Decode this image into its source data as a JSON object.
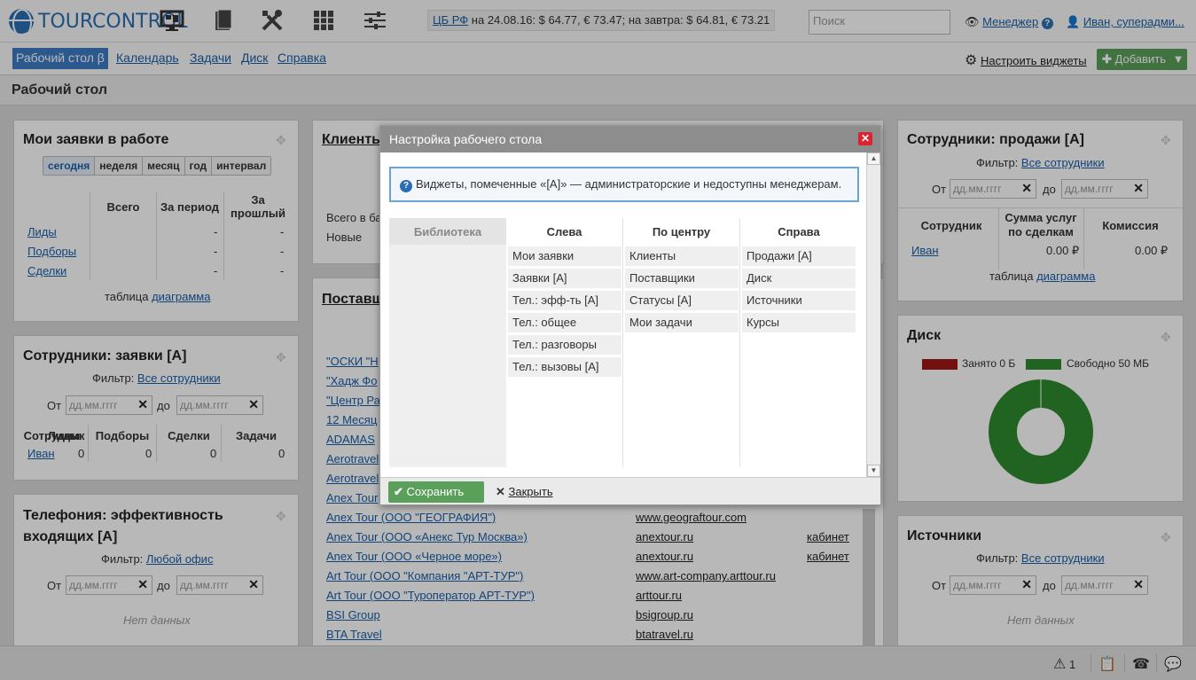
{
  "header": {
    "logo_text": "TOURCONTROL",
    "currency_link": "ЦБ РФ",
    "currency_text": "на 24.08.16: $ 64.77, € 73.47; на завтра: $ 64.81, € 73.21",
    "search_placeholder": "Поиск",
    "manager_label": "Менеджер",
    "user_label": "Иван, суперадми..."
  },
  "nav": {
    "items": [
      "Рабочий стол β",
      "Календарь",
      "Задачи",
      "Диск",
      "Справка"
    ],
    "configure_label": "Настроить виджеты",
    "add_label": "Добавить"
  },
  "page_title": "Рабочий стол",
  "widgets": {
    "my_requests": {
      "title": "Мои заявки в работе",
      "periods": [
        "сегодня",
        "неделя",
        "месяц",
        "год",
        "интервал"
      ],
      "columns": [
        "Всего",
        "За период",
        "За прошлый"
      ],
      "rows": [
        {
          "label": "Лиды",
          "values": [
            "",
            "-",
            "-"
          ]
        },
        {
          "label": "Подборы",
          "values": [
            "",
            "-",
            "-"
          ]
        },
        {
          "label": "Сделки",
          "values": [
            "",
            "-",
            "-"
          ]
        }
      ],
      "footer_text": "таблица",
      "footer_link": "диаграмма"
    },
    "staff_requests": {
      "title": "Сотрудники: заявки [А]",
      "filter_label": "Фильтр:",
      "filter_value": "Все сотрудники",
      "from_label": "От",
      "to_label": "до",
      "date_placeholder": "дд.мм.гггг",
      "columns": [
        "Сотрудник",
        "Лиды",
        "Подборы",
        "Сделки",
        "Задачи"
      ],
      "row": {
        "name": "Иван",
        "values": [
          "0",
          "0",
          "0",
          "0"
        ]
      }
    },
    "telephony": {
      "title": "Телефония: эффективность входящих [А]",
      "filter_label": "Фильтр:",
      "filter_value": "Любой офис",
      "from_label": "От",
      "to_label": "до",
      "date_placeholder": "дд.мм.гггг",
      "empty": "Нет данных"
    },
    "clients": {
      "title": "Клиенты",
      "total_label": "Всего в ба",
      "new_label": "Новые"
    },
    "suppliers": {
      "title": "Поставщ",
      "rows": [
        {
          "name": "\"ОСКИ \"Н",
          "site": "",
          "cab": ""
        },
        {
          "name": "\"Хадж Фо",
          "site": "",
          "cab": ""
        },
        {
          "name": "\"Центр Ра",
          "site": "",
          "cab": ""
        },
        {
          "name": "12 Месяц",
          "site": "",
          "cab": ""
        },
        {
          "name": "ADAMAS",
          "site": "",
          "cab": ""
        },
        {
          "name": "Aerotravel",
          "site": "",
          "cab": ""
        },
        {
          "name": "Aerotravel",
          "site": "",
          "cab": ""
        },
        {
          "name": "Anex Tour",
          "site": "",
          "cab": ""
        },
        {
          "name": "Anex Tour (ООО \"ГЕОГРАФИЯ\")",
          "site": "www.geograftour.com",
          "cab": ""
        },
        {
          "name": "Anex Tour (ООО «Анекс Тур Москва»)",
          "site": "anextour.ru",
          "cab": "кабинет"
        },
        {
          "name": "Anex Tour (ООО «Черное море»)",
          "site": "anextour.ru",
          "cab": "кабинет"
        },
        {
          "name": "Art Tour (ООО \"Компания \"АРТ-ТУР\")",
          "site": "www.art-company.arttour.ru",
          "cab": ""
        },
        {
          "name": "Art Tour (ООО \"Туроператор АРТ-ТУР\")",
          "site": "arttour.ru",
          "cab": ""
        },
        {
          "name": "BSI Group",
          "site": "bsigroup.ru",
          "cab": ""
        },
        {
          "name": "BTA Travel",
          "site": "btatravel.ru",
          "cab": ""
        }
      ]
    },
    "staff_sales": {
      "title": "Сотрудники: продажи [А]",
      "filter_label": "Фильтр:",
      "filter_value": "Все сотрудники",
      "from_label": "От",
      "to_label": "до",
      "date_placeholder": "дд.мм.гггг",
      "columns": [
        "Сотрудник",
        "Сумма услуг по сделкам",
        "Комиссия"
      ],
      "row": {
        "name": "Иван",
        "sum": "0.00 ₽",
        "commission": "0.00 ₽"
      },
      "footer_text": "таблица",
      "footer_link": "диаграмма"
    },
    "disk": {
      "title": "Диск",
      "used_label": "Занято 0 Б",
      "free_label": "Свободно 50 МБ",
      "used_color": "#a01818",
      "free_color": "#2e8a2e"
    },
    "sources": {
      "title": "Источники",
      "filter_label": "Фильтр:",
      "filter_value": "Все сотрудники",
      "from_label": "От",
      "to_label": "до",
      "date_placeholder": "дд.мм.гггг",
      "empty": "Нет данных"
    }
  },
  "modal": {
    "title": "Настройка рабочего стола",
    "info": "Виджеты, помеченные «[А]» — администраторские и недоступны менеджерам.",
    "columns": [
      {
        "title": "Библиотека",
        "items": []
      },
      {
        "title": "Слева",
        "items": [
          "Мои заявки",
          "Заявки [А]",
          "Тел.: эфф-ть [А]",
          "Тел.: общее",
          "Тел.: разговоры",
          "Тел.: вызовы [А]"
        ]
      },
      {
        "title": "По центру",
        "items": [
          "Клиенты",
          "Поставщики",
          "Статусы [А]",
          "Мои задачи"
        ]
      },
      {
        "title": "Справа",
        "items": [
          "Продажи [А]",
          "Диск",
          "Источники",
          "Курсы"
        ]
      }
    ],
    "save_label": "Сохранить",
    "close_label": "Закрыть"
  },
  "bottombar": {
    "alerts_count": "1"
  }
}
